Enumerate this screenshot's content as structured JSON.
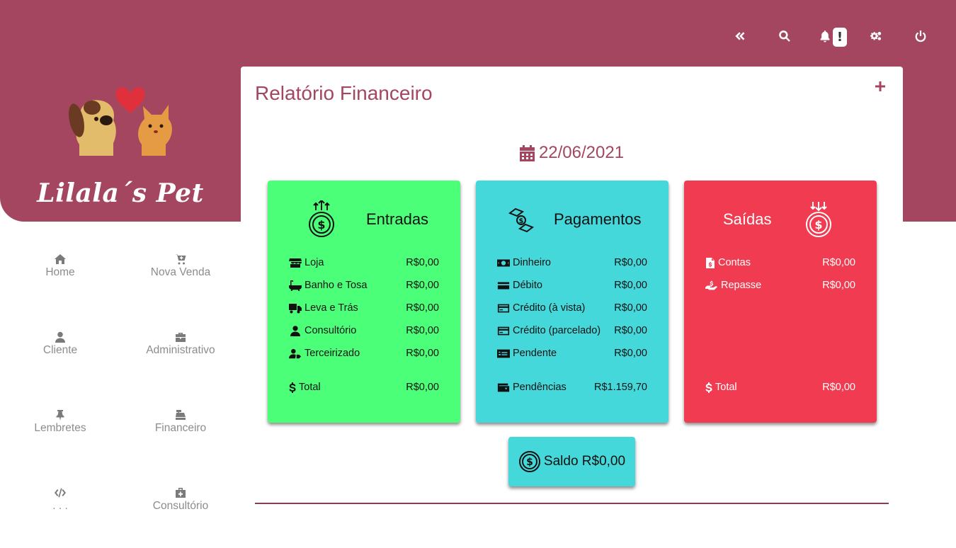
{
  "brand": {
    "name": "Lilala´s Pet"
  },
  "colors": {
    "primary": "#a4465f",
    "entradas": "#4cff79",
    "pagamentos": "#45d8da",
    "saidas": "#f13b50"
  },
  "topbar": {
    "icons": [
      "double-chevron-left-icon",
      "search-icon",
      "bell-icon",
      "cogs-icon",
      "power-icon"
    ],
    "bell_badge": "!"
  },
  "nav": {
    "items": [
      {
        "label": "Home",
        "icon": "home-icon"
      },
      {
        "label": "Nova Venda",
        "icon": "cart-plus-icon"
      },
      {
        "label": "Cliente",
        "icon": "user-icon"
      },
      {
        "label": "Administrativo",
        "icon": "briefcase-icon"
      },
      {
        "label": "Lembretes",
        "icon": "thumbtack-icon"
      },
      {
        "label": "Financeiro",
        "icon": "cash-register-icon"
      },
      {
        "label": ". . .",
        "icon": "code-icon"
      },
      {
        "label": "Consultório",
        "icon": "medkit-icon"
      }
    ]
  },
  "panel": {
    "title": "Relatório Financeiro",
    "date": "22/06/2021"
  },
  "entradas": {
    "title": "Entradas",
    "rows": [
      {
        "label": "Loja",
        "value": "R$0,00",
        "icon": "store-icon"
      },
      {
        "label": "Banho e Tosa",
        "value": "R$0,00",
        "icon": "bath-icon"
      },
      {
        "label": "Leva e Trás",
        "value": "R$0,00",
        "icon": "truck-icon"
      },
      {
        "label": "Consultório",
        "value": "R$0,00",
        "icon": "doctor-icon"
      },
      {
        "label": "Terceirizado",
        "value": "R$0,00",
        "icon": "user-tag-icon"
      }
    ],
    "total": {
      "label": "Total",
      "value": "R$0,00"
    }
  },
  "pagamentos": {
    "title": "Pagamentos",
    "rows": [
      {
        "label": "Dinheiro",
        "value": "R$0,00",
        "icon": "money-bill-icon"
      },
      {
        "label": "Débito",
        "value": "R$0,00",
        "icon": "credit-card-icon"
      },
      {
        "label": "Crédito (à vista)",
        "value": "R$0,00",
        "icon": "credit-card-icon"
      },
      {
        "label": "Crédito (parcelado)",
        "value": "R$0,00",
        "icon": "credit-card-icon"
      },
      {
        "label": "Pendente",
        "value": "R$0,00",
        "icon": "money-check-icon"
      }
    ],
    "pendencias": {
      "label": "Pendências",
      "value": "R$1.159,70"
    }
  },
  "saidas": {
    "title": "Saídas",
    "rows": [
      {
        "label": "Contas",
        "value": "R$0,00",
        "icon": "invoice-icon"
      },
      {
        "label": "Repasse",
        "value": "R$0,00",
        "icon": "hand-holding-usd-icon"
      }
    ],
    "total": {
      "label": "Total",
      "value": "R$0,00"
    }
  },
  "saldo": {
    "label": "Saldo R$0,00"
  }
}
